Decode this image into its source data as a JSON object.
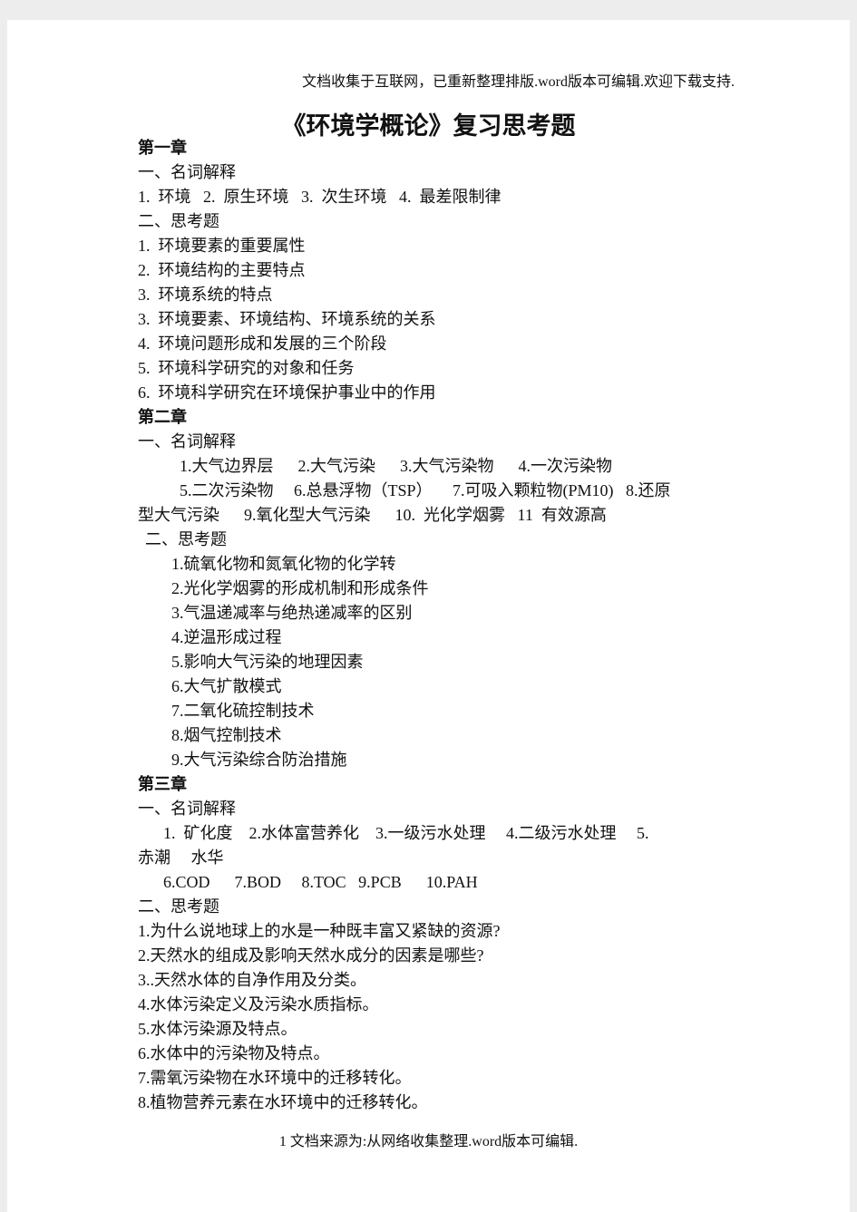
{
  "header": "文档收集于互联网，已重新整理排版.word版本可编辑.欢迎下载支持.",
  "title": "《环境学概论》复习思考题",
  "lines": [
    {
      "text": "第一章",
      "indent": 0,
      "bold": true
    },
    {
      "text": "一、名词解释",
      "indent": 0
    },
    {
      "text": "1.  环境   2.  原生环境   3.  次生环境   4.  最差限制律",
      "indent": 0
    },
    {
      "text": "二、思考题",
      "indent": 0
    },
    {
      "text": "1.  环境要素的重要属性",
      "indent": 0
    },
    {
      "text": "2.  环境结构的主要特点",
      "indent": 0
    },
    {
      "text": "3.  环境系统的特点",
      "indent": 0
    },
    {
      "text": "3.  环境要素、环境结构、环境系统的关系",
      "indent": 0
    },
    {
      "text": "4.  环境问题形成和发展的三个阶段",
      "indent": 0
    },
    {
      "text": "5.  环境科学研究的对象和任务",
      "indent": 0
    },
    {
      "text": "6.  环境科学研究在环境保护事业中的作用",
      "indent": 0
    },
    {
      "text": "第二章",
      "indent": 0,
      "bold": true
    },
    {
      "text": "一、名词解释",
      "indent": 0
    },
    {
      "text": "1.大气边界层      2.大气污染      3.大气污染物      4.一次污染物",
      "indent": 46
    },
    {
      "text": "5.二次污染物     6.总悬浮物（TSP）     7.可吸入颗粒物(PM10)   8.还原",
      "indent": 46
    },
    {
      "text": "型大气污染      9.氧化型大气污染      10.  光化学烟雾   11  有效源高",
      "indent": 0
    },
    {
      "text": "二、思考题",
      "indent": 8
    },
    {
      "text": "1.硫氧化物和氮氧化物的化学转",
      "indent": 37
    },
    {
      "text": "2.光化学烟雾的形成机制和形成条件",
      "indent": 37
    },
    {
      "text": "3.气温递减率与绝热递减率的区别",
      "indent": 37
    },
    {
      "text": "4.逆温形成过程",
      "indent": 37
    },
    {
      "text": "5.影响大气污染的地理因素",
      "indent": 37
    },
    {
      "text": "6.大气扩散模式",
      "indent": 37
    },
    {
      "text": "7.二氧化硫控制技术",
      "indent": 37
    },
    {
      "text": "8.烟气控制技术",
      "indent": 37
    },
    {
      "text": "9.大气污染综合防治措施",
      "indent": 37
    },
    {
      "text": "第三章",
      "indent": 0,
      "bold": true
    },
    {
      "text": "一、名词解释",
      "indent": 0
    },
    {
      "text": "1.  矿化度    2.水体富营养化    3.一级污水处理     4.二级污水处理     5.",
      "indent": 28
    },
    {
      "text": "赤潮     水华",
      "indent": 0
    },
    {
      "text": "6.COD      7.BOD     8.TOC   9.PCB      10.PAH",
      "indent": 28
    },
    {
      "text": "二、思考题",
      "indent": 0
    },
    {
      "text": "1.为什么说地球上的水是一种既丰富又紧缺的资源?",
      "indent": 0
    },
    {
      "text": "2.天然水的组成及影响天然水成分的因素是哪些?",
      "indent": 0
    },
    {
      "text": "3..天然水体的自净作用及分类。",
      "indent": 0
    },
    {
      "text": "4.水体污染定义及污染水质指标。",
      "indent": 0
    },
    {
      "text": "5.水体污染源及特点。",
      "indent": 0
    },
    {
      "text": "6.水体中的污染物及特点。",
      "indent": 0
    },
    {
      "text": "7.需氧污染物在水环境中的迁移转化。",
      "indent": 0
    },
    {
      "text": "8.植物营养元素在水环境中的迁移转化。",
      "indent": 0
    }
  ],
  "footer": "1 文档来源为:从网络收集整理.word版本可编辑."
}
